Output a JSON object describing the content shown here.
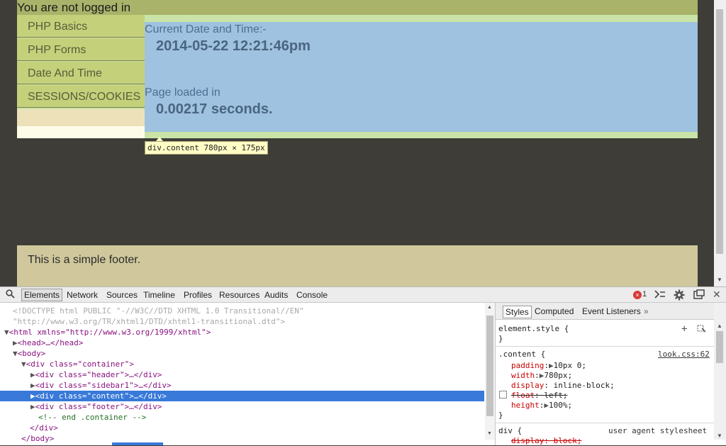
{
  "page": {
    "login_status": "You are not logged in",
    "sidebar": [
      {
        "label": "PHP Basics"
      },
      {
        "label": "PHP Forms"
      },
      {
        "label": "Date And Time"
      },
      {
        "label": "SESSIONS/COOKIES"
      }
    ],
    "content": {
      "datetime_label": "Current Date and Time:-",
      "datetime_value": "2014-05-22 12:21:46pm",
      "loadtime_label": "Page loaded in",
      "loadtime_value": "0.00217 seconds."
    },
    "tooltip": {
      "selector": "div.content",
      "size": "780px × 175px"
    },
    "footer_text": "This is a simple footer."
  },
  "devtools": {
    "tabs": [
      "Elements",
      "Network",
      "Sources",
      "Timeline",
      "Profiles",
      "Resources",
      "Audits",
      "Console"
    ],
    "error_count": "1",
    "dom_lines": [
      "<!DOCTYPE html PUBLIC \"-//W3C//DTD XHTML 1.0 Transitional//EN\"",
      "\"http://www.w3.org/TR/xhtml1/DTD/xhtml1-transitional.dtd\">",
      "<html xmlns=\"http://www.w3.org/1999/xhtml\">",
      "<head>…</head>",
      "<body>",
      "<div class=\"container\">",
      "<div class=\"header\">…</div>",
      "<div class=\"sidebar1\">…</div>",
      "<div class=\"content\">…</div>",
      "<div class=\"footer\">…</div>",
      "<!-- end .container -->",
      "</div>",
      "</body>"
    ],
    "styles_tabs": [
      "Styles",
      "Computed",
      "Event Listeners"
    ],
    "styles": {
      "element_style": "element.style {",
      "close_brace": "}",
      "rule_selector": ".content {",
      "rule_source": "look.css:62",
      "props": [
        {
          "name": "padding",
          "value": "10px 0;"
        },
        {
          "name": "width",
          "value": "780px;"
        },
        {
          "name": "display",
          "value": "inline-block;"
        },
        {
          "name": "float",
          "value": "left;"
        },
        {
          "name": "height",
          "value": "100%;"
        }
      ],
      "ua_selector": "div {",
      "ua_source": "user agent stylesheet",
      "ua_prop": "display: block;"
    }
  }
}
